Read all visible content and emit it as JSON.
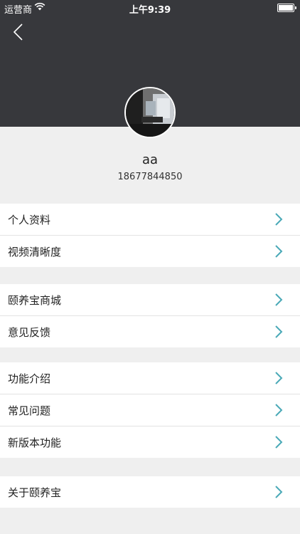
{
  "status_bar": {
    "carrier": "运营商",
    "time": "上午9:39"
  },
  "icons": {
    "back": "chevron-left-icon",
    "row_arrow": "chevron-right-icon",
    "wifi": "wifi-icon",
    "battery": "battery-icon"
  },
  "profile": {
    "name": "aa",
    "phone": "18677844850"
  },
  "colors": {
    "header_bg": "#37383c",
    "accent_chevron": "#4aa9b7",
    "page_bg": "#efefef"
  },
  "menu": {
    "personal_info": "个人资料",
    "video_quality": "视频清晰度",
    "mall": "颐养宝商城",
    "feedback": "意见反馈",
    "features": "功能介绍",
    "faq": "常见问题",
    "new_features": "新版本功能",
    "about": "关于颐养宝"
  }
}
